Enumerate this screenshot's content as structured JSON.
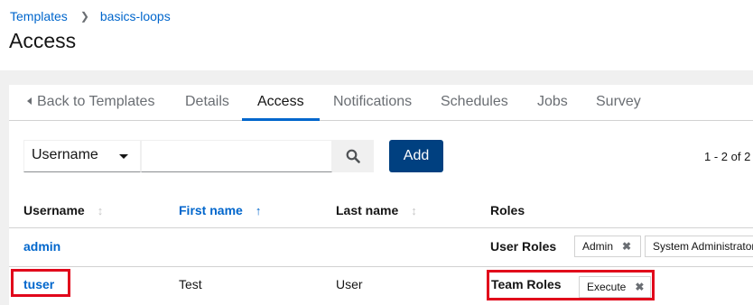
{
  "breadcrumb": {
    "parent": "Templates",
    "current": "basics-loops"
  },
  "page": {
    "title": "Access"
  },
  "tabs": {
    "back": "Back to Templates",
    "details": "Details",
    "access": "Access",
    "notifications": "Notifications",
    "schedules": "Schedules",
    "jobs": "Jobs",
    "survey": "Survey"
  },
  "toolbar": {
    "filter_field": "Username",
    "search_value": "",
    "add_label": "Add",
    "pagination": "1 - 2 of 2"
  },
  "table": {
    "headers": {
      "username": "Username",
      "first_name": "First name",
      "last_name": "Last name",
      "roles": "Roles"
    },
    "sorted_by": "First name",
    "rows": [
      {
        "username": "admin",
        "first_name": "",
        "last_name": "",
        "roles_label": "User Roles",
        "roles": [
          "Admin",
          "System Administrator"
        ]
      },
      {
        "username": "tuser",
        "first_name": "Test",
        "last_name": "User",
        "roles_label": "Team Roles",
        "roles": [
          "Execute"
        ]
      }
    ]
  },
  "colors": {
    "accent": "#0066cc",
    "primary_button": "#004080",
    "highlight": "#e1071b"
  }
}
